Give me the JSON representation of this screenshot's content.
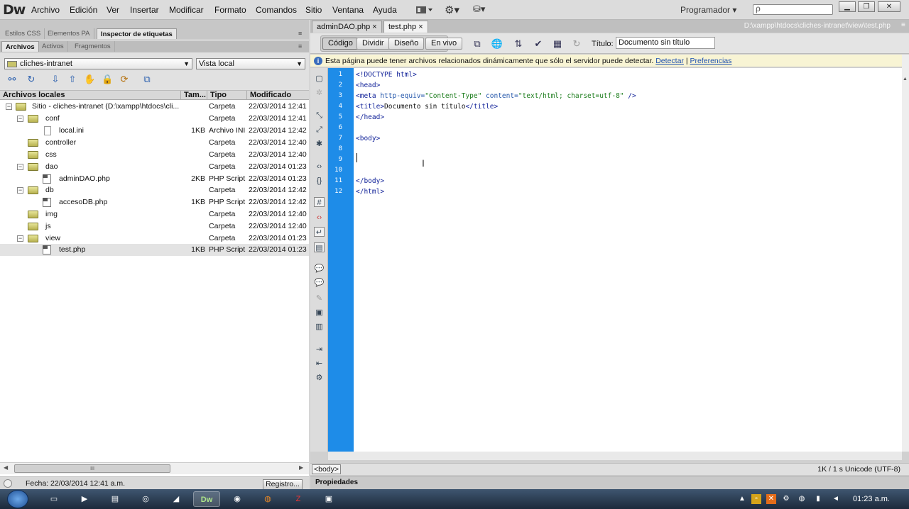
{
  "menubar": {
    "logo": "Dw",
    "items": [
      "Archivo",
      "Edición",
      "Ver",
      "Insertar",
      "Modificar",
      "Formato",
      "Comandos",
      "Sitio",
      "Ventana",
      "Ayuda"
    ],
    "workspace": "Programador",
    "search_icon": "ρ"
  },
  "left_panel": {
    "tabs_top": [
      "Estilos CSS",
      "Elementos PA",
      "Inspector de etiquetas"
    ],
    "tabs_files": [
      "Archivos",
      "Activos",
      "Fragmentos"
    ],
    "site_select": "cliches-intranet",
    "view_select": "Vista local",
    "columns": [
      "Archivos locales",
      "Tam...",
      "Tipo",
      "Modificado"
    ],
    "rows": [
      {
        "name": "Sitio - cliches-intranet (D:\\xampp\\htdocs\\cli...",
        "size": "",
        "type": "Carpeta",
        "mod": "22/03/2014 12:41"
      },
      {
        "name": "conf",
        "size": "",
        "type": "Carpeta",
        "mod": "22/03/2014 12:41"
      },
      {
        "name": "local.ini",
        "size": "1KB",
        "type": "Archivo INI",
        "mod": "22/03/2014 12:42"
      },
      {
        "name": "controller",
        "size": "",
        "type": "Carpeta",
        "mod": "22/03/2014 12:40"
      },
      {
        "name": "css",
        "size": "",
        "type": "Carpeta",
        "mod": "22/03/2014 12:40"
      },
      {
        "name": "dao",
        "size": "",
        "type": "Carpeta",
        "mod": "22/03/2014 01:23"
      },
      {
        "name": "adminDAO.php",
        "size": "2KB",
        "type": "PHP Script",
        "mod": "22/03/2014 01:23"
      },
      {
        "name": "db",
        "size": "",
        "type": "Carpeta",
        "mod": "22/03/2014 12:42"
      },
      {
        "name": "accesoDB.php",
        "size": "1KB",
        "type": "PHP Script",
        "mod": "22/03/2014 12:42"
      },
      {
        "name": "img",
        "size": "",
        "type": "Carpeta",
        "mod": "22/03/2014 12:40"
      },
      {
        "name": "js",
        "size": "",
        "type": "Carpeta",
        "mod": "22/03/2014 12:40"
      },
      {
        "name": "view",
        "size": "",
        "type": "Carpeta",
        "mod": "22/03/2014 01:23"
      },
      {
        "name": "test.php",
        "size": "1KB",
        "type": "PHP Script",
        "mod": "22/03/2014 01:23"
      }
    ],
    "scroll_grip": "III",
    "status_text": "Fecha: 22/03/2014 12:41 a.m.",
    "log_button": "Registro..."
  },
  "doc": {
    "tabs": [
      "adminDAO.php",
      "test.php"
    ],
    "tab_close": "×",
    "path": "D:\\xampp\\htdocs\\cliches-intranet\\view\\test.php",
    "views": [
      "Código",
      "Dividir",
      "Diseño",
      "En vivo"
    ],
    "title_label": "Título:",
    "title_value": "Documento sin título",
    "info_text": "Esta página puede tener archivos relacionados dinámicamente que sólo el servidor puede detectar.",
    "info_link1": "Detectar",
    "info_sep": "|",
    "info_link2": "Preferencias",
    "line_numbers": [
      "1",
      "2",
      "3",
      "4",
      "5",
      "6",
      "7",
      "8",
      "9",
      "10",
      "11",
      "12"
    ],
    "code": {
      "l1": "<!DOCTYPE html>",
      "l2": "<head>",
      "l3a": "<meta ",
      "l3b": "http-equiv=",
      "l3c": "\"Content-Type\"",
      "l3d": " content=",
      "l3e": "\"text/html; charset=utf-8\"",
      "l3f": " />",
      "l4a": "<title>",
      "l4b": "Documento sin título",
      "l4c": "</title>",
      "l5": "</head>",
      "l7": "<body>",
      "l11": "</body>",
      "l12": "</html>"
    },
    "tag_selector": "<body>",
    "encoding": "1K / 1 s  Unicode (UTF-8)",
    "properties": "Propiedades"
  },
  "taskbar": {
    "clock": "01:23 a.m."
  }
}
